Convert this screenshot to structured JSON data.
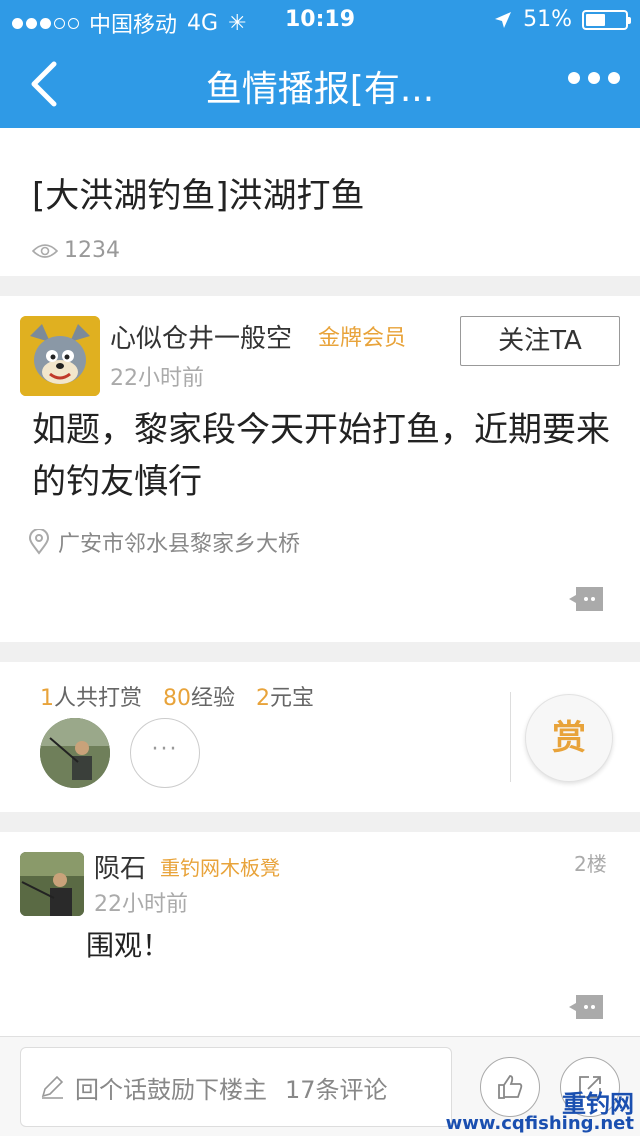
{
  "status_bar": {
    "carrier": "中国移动",
    "network": "4G",
    "time": "10:19",
    "battery": "51%",
    "battery_level": 0.51
  },
  "nav": {
    "title": "鱼情播报[有..."
  },
  "thread": {
    "title": "[大洪湖钓鱼]洪湖打鱼",
    "views": "1234"
  },
  "post": {
    "username": "心似仓井一般空",
    "badge": "金牌会员",
    "time_ago": "22小时前",
    "follow_label": "关注TA",
    "content": "如题，黎家段今天开始打鱼，近期要来的钓友慎行",
    "location": "广安市邻水县黎家乡大桥"
  },
  "reward": {
    "count": "1",
    "count_label": "人共打赏",
    "exp": "80",
    "exp_label": "经验",
    "coins": "2",
    "coins_label": "元宝",
    "button_label": "赏"
  },
  "reply": {
    "username": "陨石",
    "badge": "重钓网木板凳",
    "time_ago": "22小时前",
    "floor": "2楼",
    "content": "围观！"
  },
  "bottom_bar": {
    "placeholder": "回个话鼓励下楼主",
    "comments": "17条评论"
  },
  "watermark": {
    "brand": "重钓网",
    "url": "www.cqfishing.net"
  },
  "colors": {
    "accent": "#2f9ae6",
    "gold": "#e8a33a"
  }
}
